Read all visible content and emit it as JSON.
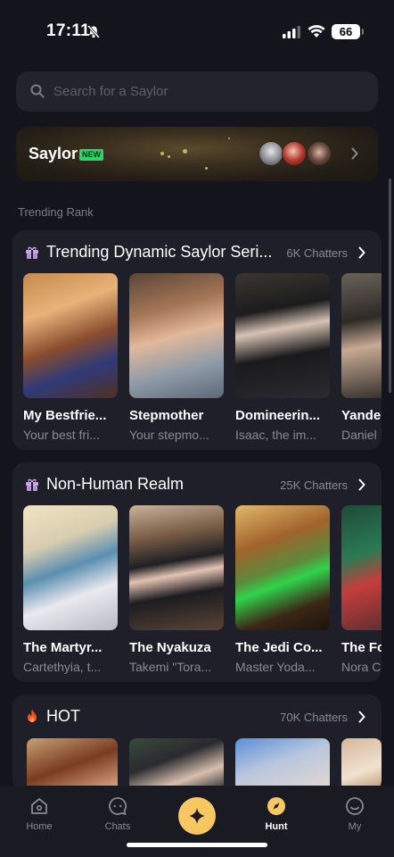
{
  "status_bar": {
    "time": "17:11",
    "battery": "66"
  },
  "search": {
    "placeholder": "Search for a Saylor"
  },
  "banner": {
    "title": "Saylor",
    "badge": "NEW"
  },
  "trending_label": "Trending Rank",
  "sections": [
    {
      "icon": "gift-icon",
      "title": "Trending Dynamic Saylor Seri...",
      "count": "6K Chatters",
      "items": [
        {
          "name": "My Bestfrie...",
          "desc": "Your best fri..."
        },
        {
          "name": "Stepmother",
          "desc": "Your stepmo..."
        },
        {
          "name": "Domineerin...",
          "desc": "Isaac, the im..."
        },
        {
          "name": "Yande",
          "desc": "Daniel"
        }
      ]
    },
    {
      "icon": "gift-icon",
      "title": "Non-Human Realm",
      "count": "25K Chatters",
      "items": [
        {
          "name": "The Martyr...",
          "desc": "Cartethyia, t..."
        },
        {
          "name": "The Nyakuza",
          "desc": "Takemi \"Tora..."
        },
        {
          "name": "The Jedi Co...",
          "desc": "Master Yoda..."
        },
        {
          "name": "The Fo",
          "desc": "Nora C"
        }
      ]
    },
    {
      "icon": "fire-icon",
      "title": "HOT",
      "count": "70K Chatters",
      "items": []
    }
  ],
  "nav": {
    "home": "Home",
    "chats": "Chats",
    "hunt": "Hunt",
    "my": "My"
  },
  "colors": {
    "accent": "#f7c862",
    "new_badge": "#2fd36b"
  }
}
